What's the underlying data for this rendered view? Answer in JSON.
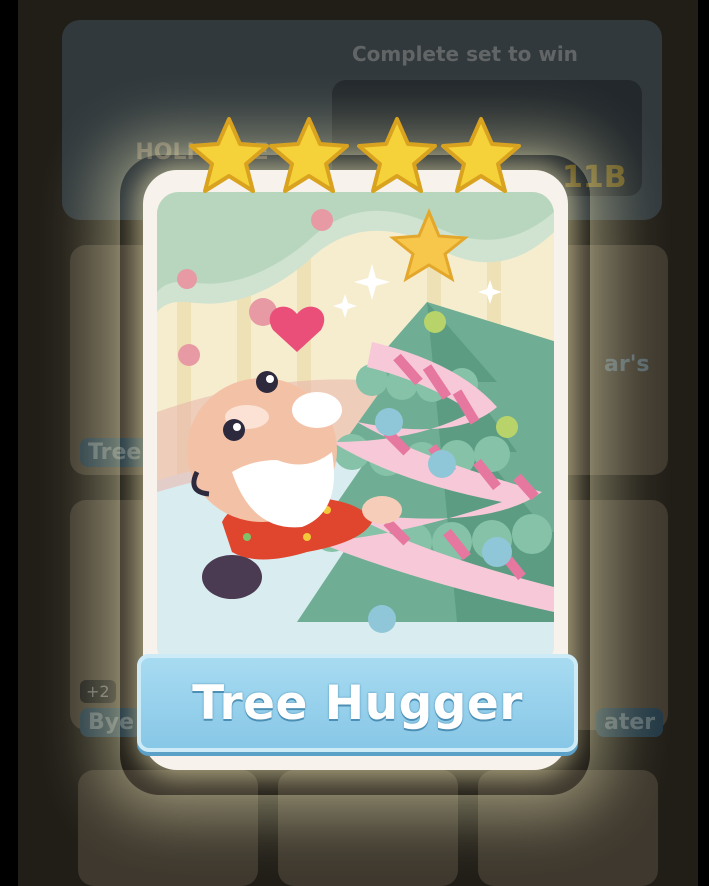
{
  "background": {
    "album_title": "HOLI OBSE",
    "prompt": "Complete set to win",
    "prize_value": "11B",
    "side_labels": [
      "Tree",
      "Bye",
      "ater",
      "ar's"
    ],
    "plus_badge": "+2"
  },
  "card": {
    "name": "Tree Hugger",
    "stars": 4,
    "accent_color": "#86c6e6",
    "star_color": "#f6d23a"
  }
}
